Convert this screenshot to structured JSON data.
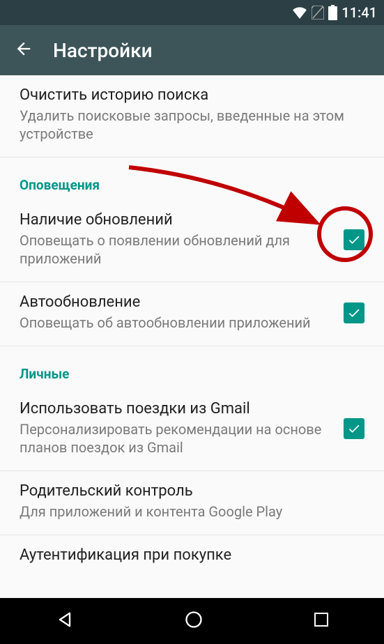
{
  "status_bar": {
    "time": "11:41"
  },
  "app_bar": {
    "title": "Настройки"
  },
  "rows": {
    "clear_search": {
      "title": "Очистить историю поиска",
      "subtitle": "Удалить поисковые запросы, введенные на этом устройстве"
    },
    "section_notifications": "Оповещения",
    "updates_available": {
      "title": "Наличие обновлений",
      "subtitle": "Оповещать о появлении обновлений для приложений",
      "checked": true
    },
    "auto_update": {
      "title": "Автообновление",
      "subtitle": "Оповещать об автообновлении приложений",
      "checked": true
    },
    "section_personal": "Личные",
    "gmail_trips": {
      "title": "Использовать поездки из Gmail",
      "subtitle": "Персонализировать рекомендации на основе планов поездок из Gmail",
      "checked": true
    },
    "parental": {
      "title": "Родительский контроль",
      "subtitle": "Для приложений и контента Google Play"
    },
    "auth": {
      "title": "Аутентификация при покупке"
    }
  }
}
